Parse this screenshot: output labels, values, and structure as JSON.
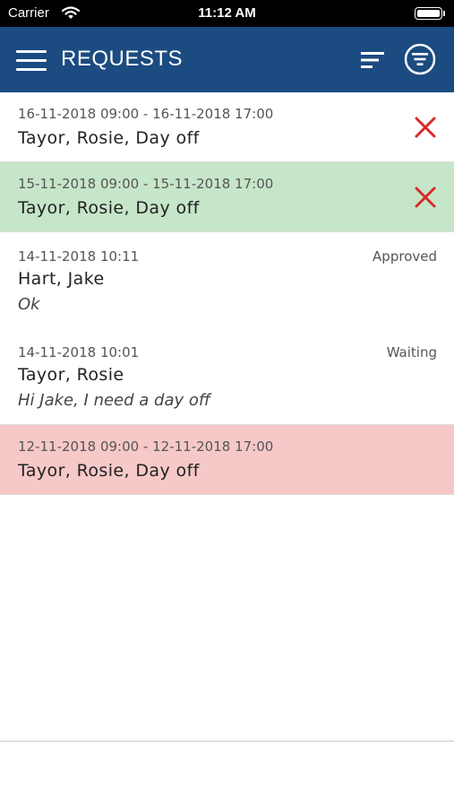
{
  "status_bar": {
    "carrier": "Carrier",
    "time": "11:12 AM"
  },
  "header": {
    "title": "REQUESTS",
    "icons": [
      "menu-icon",
      "sort-icon",
      "filter-icon"
    ]
  },
  "requests": [
    {
      "type": "range",
      "date": "16-11-2018 09:00 - 16-11-2018 17:00",
      "title": "Tayor, Rosie, Day off",
      "state": "pending",
      "action_icon": "close-icon"
    },
    {
      "type": "range",
      "date": "15-11-2018 09:00 - 15-11-2018 17:00",
      "title": "Tayor, Rosie, Day off",
      "state": "approved",
      "action_icon": "close-icon"
    },
    {
      "type": "message",
      "date": "14-11-2018 10:11",
      "title": "Hart, Jake",
      "comment": "Ok",
      "status": "Approved"
    },
    {
      "type": "message",
      "date": "14-11-2018 10:01",
      "title": "Tayor, Rosie",
      "comment": "Hi Jake, I need a day off",
      "status": "Waiting"
    },
    {
      "type": "range",
      "date": "12-11-2018 09:00 - 12-11-2018 17:00",
      "title": "Tayor, Rosie, Day off",
      "state": "rejected"
    }
  ],
  "colors": {
    "header_bg": "#1b4b80",
    "approved_bg": "#c6e6c9",
    "rejected_bg": "#f6c8c8",
    "cancel_icon": "#d62b2b"
  }
}
